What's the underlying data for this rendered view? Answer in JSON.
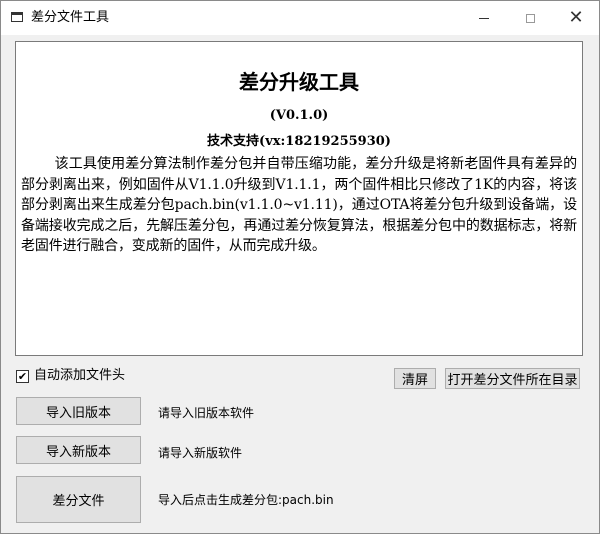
{
  "window": {
    "title": "差分文件工具",
    "close_glyph": "✕"
  },
  "display": {
    "title": "差分升级工具",
    "version": "(V0.1.0)",
    "support": "技术支持(vx:18219255930)",
    "body": "该工具使用差分算法制作差分包并自带压缩功能，差分升级是将新老固件具有差异的部分剥离出来，例如固件从V1.1.0升级到V1.1.1，两个固件相比只修改了1K的内容，将该部分剥离出来生成差分包pach.bin(v1.1.0~v1.11)，通过OTA将差分包升级到设备端，设备端接收完成之后，先解压差分包，再通过差分恢复算法，根据差分包中的数据标志，将新老固件进行融合，变成新的固件，从而完成升级。"
  },
  "options": {
    "auto_header_label": "自动添加文件头",
    "auto_header_checked": true,
    "check_glyph": "✔"
  },
  "buttons": {
    "clear": "清屏",
    "open_dir": "打开差分文件所在目录",
    "import_old": "导入旧版本",
    "import_new": "导入新版本",
    "diff": "差分文件"
  },
  "status": {
    "old": "请导入旧版本软件",
    "new": "请导入新版软件",
    "diff": "导入后点击生成差分包:pach.bin"
  },
  "colors": {
    "window_bg": "#f0f0f0",
    "button_bg": "#e1e1e1",
    "button_border": "#adadad",
    "display_bg": "#ffffff"
  },
  "icons": {
    "app": "window-app-icon",
    "minimize": "minimize-icon",
    "maximize": "maximize-icon",
    "close": "close-icon",
    "check": "checkmark-icon"
  }
}
